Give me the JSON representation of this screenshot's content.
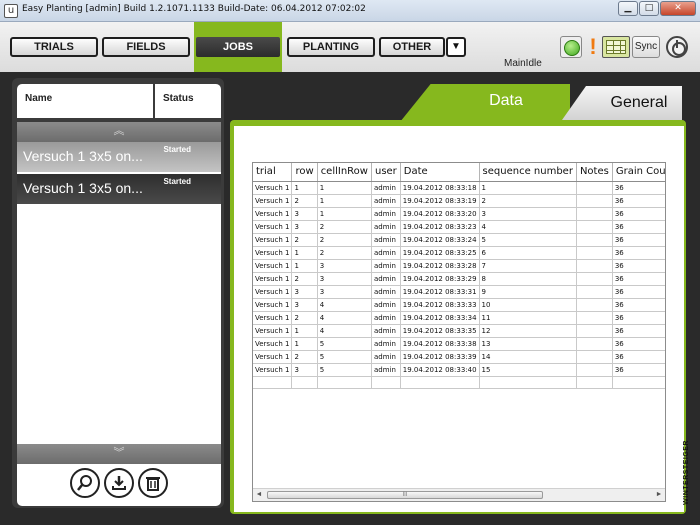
{
  "window": {
    "title": "Easy Planting [admin] Build 1.2.1071.1133  Build-Date: 06.04.2012 07:02:02",
    "app_icon": "u",
    "minimize": "▁",
    "maximize": "□",
    "close": "✕"
  },
  "toolbar": {
    "buttons": [
      "TRIALS",
      "FIELDS",
      "JOBS",
      "PLANTING",
      "OTHER"
    ],
    "active": "JOBS",
    "dropdown_icon": "▼",
    "status_text": "MainIdle",
    "warning_icon": "!",
    "sync_label": "Sync",
    "accent_color": "#86b81e"
  },
  "left": {
    "headers": {
      "name": "Name",
      "status": "Status"
    },
    "scroll_up_icon": "︽",
    "scroll_down_icon": "︾",
    "jobs": [
      {
        "name": "Versuch 1 3x5 on...",
        "status": "Started"
      },
      {
        "name": "Versuch 1 3x5 on...",
        "status": "Started"
      }
    ],
    "action_icons": [
      "search-icon",
      "download-icon",
      "trash-icon"
    ]
  },
  "tabs": {
    "data": "Data",
    "general": "General"
  },
  "grid": {
    "columns": [
      "trial",
      "row",
      "cellInRow",
      "user",
      "Date",
      "sequence number",
      "Notes",
      "Grain Cou"
    ],
    "rows": [
      [
        "Versuch 1",
        "1",
        "1",
        "admin",
        "19.04.2012 08:33:18",
        "1",
        "",
        "36"
      ],
      [
        "Versuch 1",
        "2",
        "1",
        "admin",
        "19.04.2012 08:33:19",
        "2",
        "",
        "36"
      ],
      [
        "Versuch 1",
        "3",
        "1",
        "admin",
        "19.04.2012 08:33:20",
        "3",
        "",
        "36"
      ],
      [
        "Versuch 1",
        "3",
        "2",
        "admin",
        "19.04.2012 08:33:23",
        "4",
        "",
        "36"
      ],
      [
        "Versuch 1",
        "2",
        "2",
        "admin",
        "19.04.2012 08:33:24",
        "5",
        "",
        "36"
      ],
      [
        "Versuch 1",
        "1",
        "2",
        "admin",
        "19.04.2012 08:33:25",
        "6",
        "",
        "36"
      ],
      [
        "Versuch 1",
        "1",
        "3",
        "admin",
        "19.04.2012 08:33:28",
        "7",
        "",
        "36"
      ],
      [
        "Versuch 1",
        "2",
        "3",
        "admin",
        "19.04.2012 08:33:29",
        "8",
        "",
        "36"
      ],
      [
        "Versuch 1",
        "3",
        "3",
        "admin",
        "19.04.2012 08:33:31",
        "9",
        "",
        "36"
      ],
      [
        "Versuch 1",
        "3",
        "4",
        "admin",
        "19.04.2012 08:33:33",
        "10",
        "",
        "36"
      ],
      [
        "Versuch 1",
        "2",
        "4",
        "admin",
        "19.04.2012 08:33:34",
        "11",
        "",
        "36"
      ],
      [
        "Versuch 1",
        "1",
        "4",
        "admin",
        "19.04.2012 08:33:35",
        "12",
        "",
        "36"
      ],
      [
        "Versuch 1",
        "1",
        "5",
        "admin",
        "19.04.2012 08:33:38",
        "13",
        "",
        "36"
      ],
      [
        "Versuch 1",
        "2",
        "5",
        "admin",
        "19.04.2012 08:33:39",
        "14",
        "",
        "36"
      ],
      [
        "Versuch 1",
        "3",
        "5",
        "admin",
        "19.04.2012 08:33:40",
        "15",
        "",
        "36"
      ]
    ],
    "scroll_thumb": "III"
  },
  "brand": "WINTERSTEIGER"
}
